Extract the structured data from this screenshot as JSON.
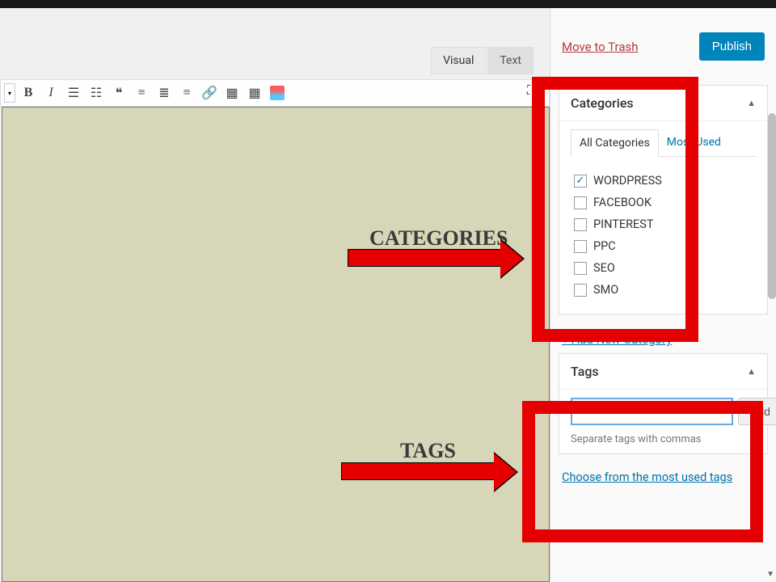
{
  "editor": {
    "tabs": {
      "visual": "Visual",
      "text": "Text"
    }
  },
  "callouts": {
    "categories": "CATEGORIES",
    "tags": "TAGS"
  },
  "publish": {
    "trash": "Move to Trash",
    "publish_btn": "Publish"
  },
  "categories": {
    "title": "Categories",
    "all_tab": "All Categories",
    "most_used_tab": "Most Used",
    "items": [
      {
        "label": "WORDPRESS",
        "checked": true
      },
      {
        "label": "FACEBOOK",
        "checked": false
      },
      {
        "label": "PINTEREST",
        "checked": false
      },
      {
        "label": "PPC",
        "checked": false
      },
      {
        "label": "SEO",
        "checked": false
      },
      {
        "label": "SMO",
        "checked": false
      }
    ],
    "add_new": "+ Add New Category"
  },
  "tags": {
    "title": "Tags",
    "input_value": "",
    "add_btn": "Add",
    "hint": "Separate tags with commas",
    "most_used_link": "Choose from the most used tags"
  }
}
